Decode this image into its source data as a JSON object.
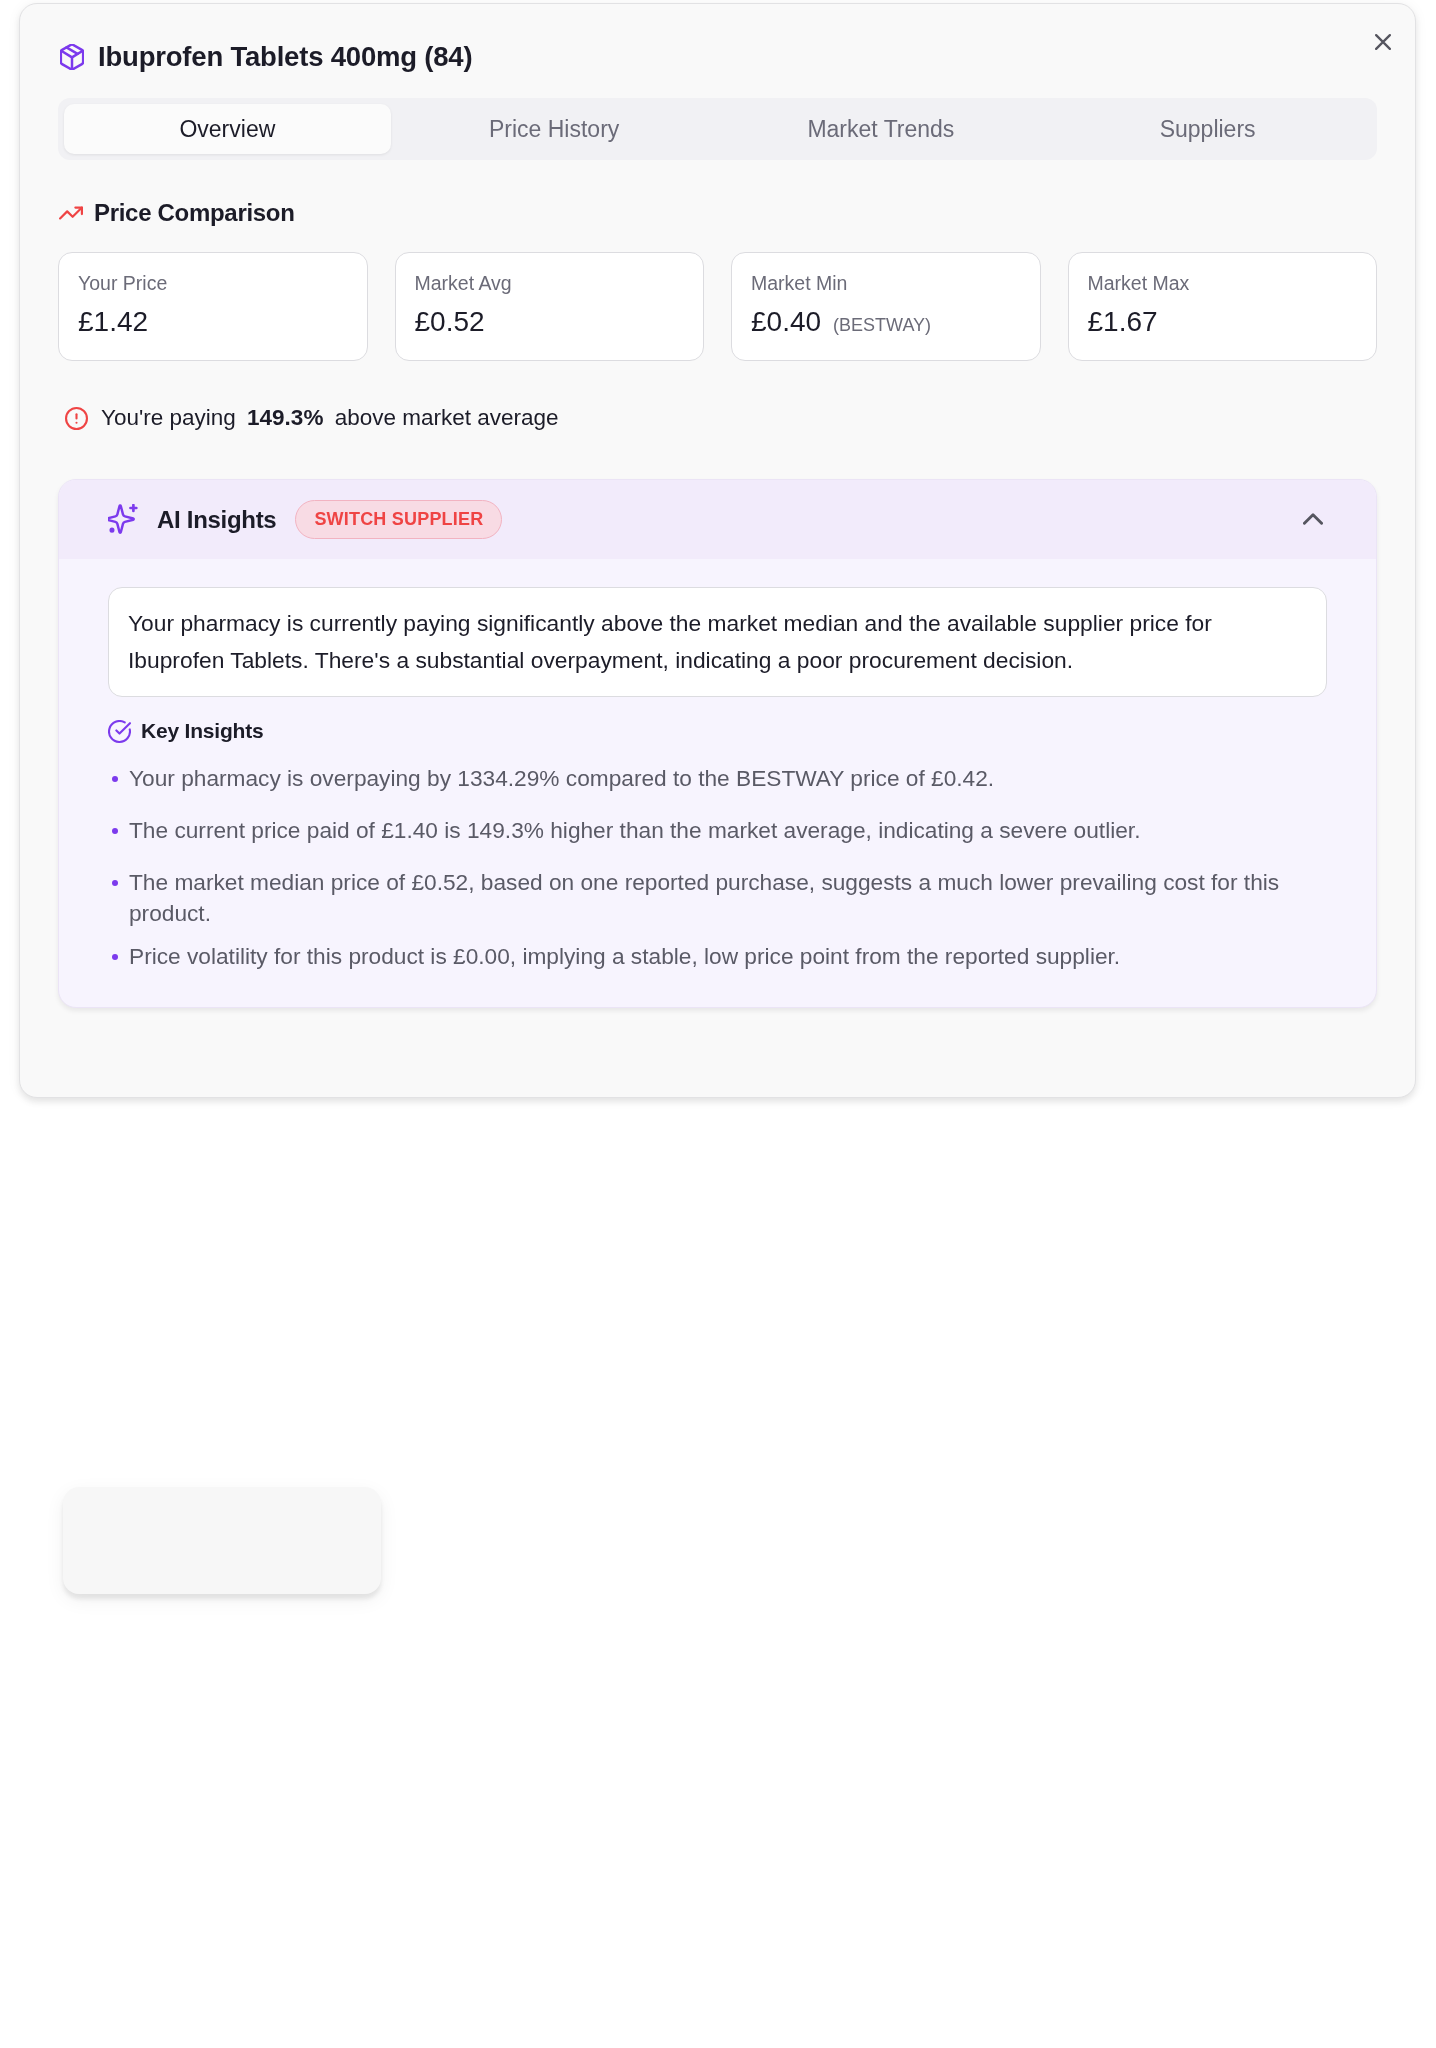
{
  "dialog": {
    "title": "Ibuprofen Tablets 400mg (84)"
  },
  "tabs": [
    {
      "label": "Overview",
      "selected": true
    },
    {
      "label": "Price History",
      "selected": false
    },
    {
      "label": "Market Trends",
      "selected": false
    },
    {
      "label": "Suppliers",
      "selected": false
    }
  ],
  "price_comparison": {
    "heading": "Price Comparison",
    "cards": [
      {
        "label": "Your Price",
        "value": "£1.42"
      },
      {
        "label": "Market Avg",
        "value": "£0.52"
      },
      {
        "label": "Market Min",
        "value": "£0.40",
        "note": "(BESTWAY)"
      },
      {
        "label": "Market Max",
        "value": "£1.67"
      }
    ],
    "alert": "You're paying **149.3%** above market average"
  },
  "ai_insights": {
    "title": "AI Insights",
    "badge": "SWITCH SUPPLIER",
    "expanded": true,
    "summary": "Your pharmacy is currently paying significantly above the market median and the available supplier price for Ibuprofen Tablets. There's a substantial overpayment, indicating a poor procurement decision.",
    "key_insights": {
      "heading": "Key Insights",
      "items": [
        "Your pharmacy is overpaying by 1334.29% compared to the BESTWAY price of £0.42.",
        "The current price paid of £1.40 is 149.3% higher than the market average, indicating a severe outlier.",
        "The market median price of £0.52, based on one reported purchase, suggests a much lower prevailing cost for this product.",
        "Price volatility for this product is £0.00, implying a stable, low price point from the reported supplier."
      ]
    }
  }
}
